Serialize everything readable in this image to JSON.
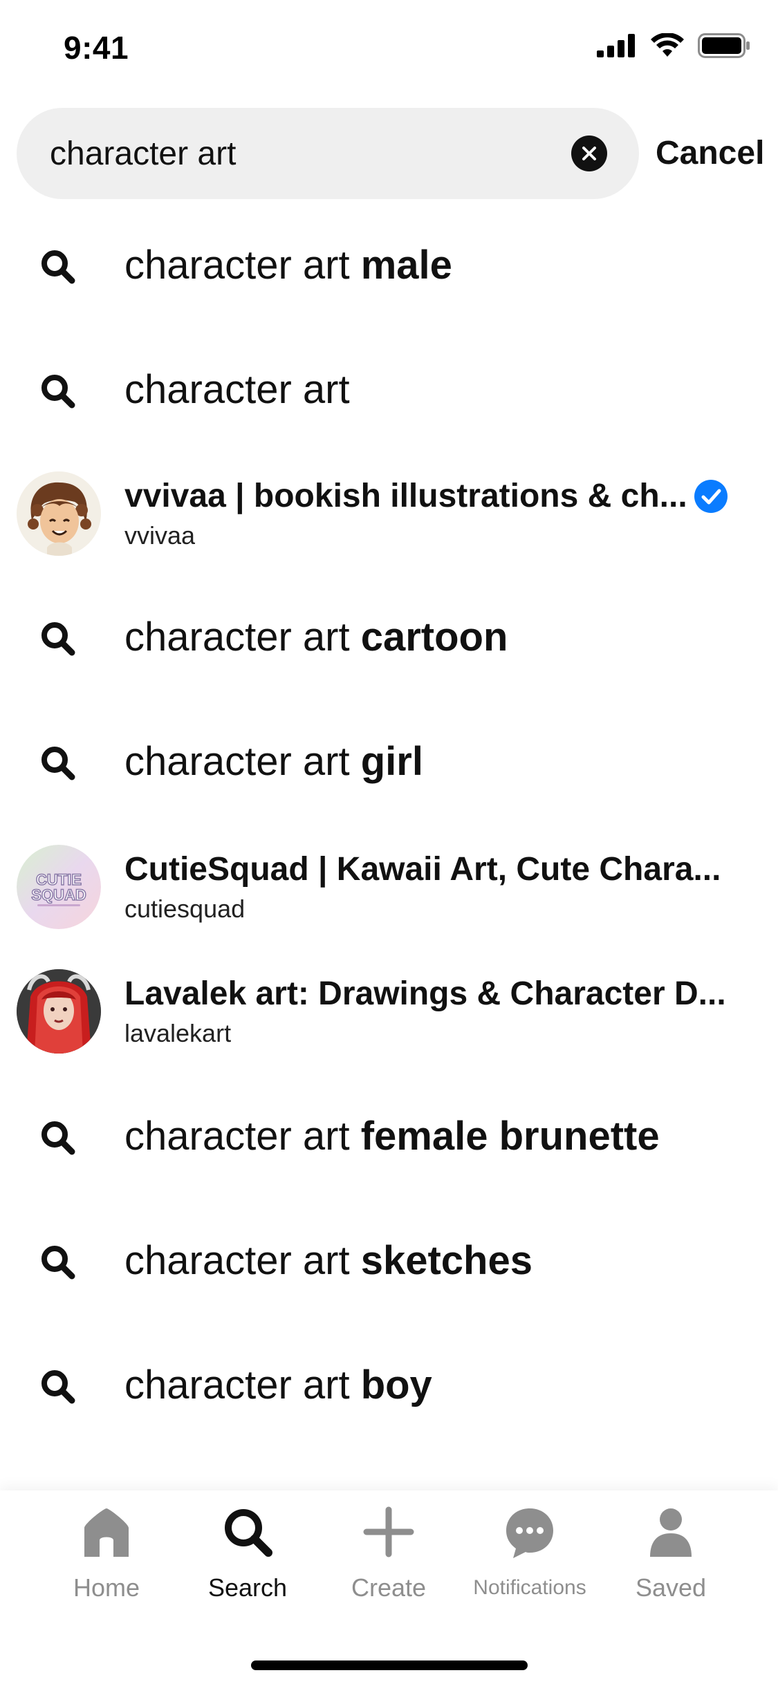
{
  "status_bar": {
    "time": "9:41"
  },
  "search": {
    "value": "character art",
    "cancel_label": "Cancel",
    "clear_icon": "clear-x-icon"
  },
  "suggestions": [
    {
      "type": "query",
      "base": "character art",
      "bold": "male"
    },
    {
      "type": "query",
      "base": "character art",
      "bold": ""
    },
    {
      "type": "profile",
      "name": "vvivaa | bookish illustrations & ch...",
      "handle": "vvivaa",
      "verified": true
    },
    {
      "type": "query",
      "base": "character art",
      "bold": "cartoon"
    },
    {
      "type": "query",
      "base": "character art",
      "bold": "girl"
    },
    {
      "type": "profile",
      "name": "CutieSquad | Kawaii Art, Cute Chara...",
      "handle": "cutiesquad",
      "verified": false,
      "avatar_text": [
        "CUTIE",
        "SQUAD"
      ]
    },
    {
      "type": "profile",
      "name": "Lavalek art: Drawings & Character D...",
      "handle": "lavalekart",
      "verified": false
    },
    {
      "type": "query",
      "base": "character art",
      "bold": "female brunette"
    },
    {
      "type": "query",
      "base": "character art",
      "bold": "sketches"
    },
    {
      "type": "query",
      "base": "character art",
      "bold": "boy"
    }
  ],
  "nav": {
    "home": "Home",
    "search": "Search",
    "create": "Create",
    "notifications": "Notifications",
    "saved": "Saved"
  },
  "colors": {
    "accent_blue": "#0a7cff",
    "field_bg": "#efefef",
    "inactive_nav": "#8e8e8e"
  }
}
